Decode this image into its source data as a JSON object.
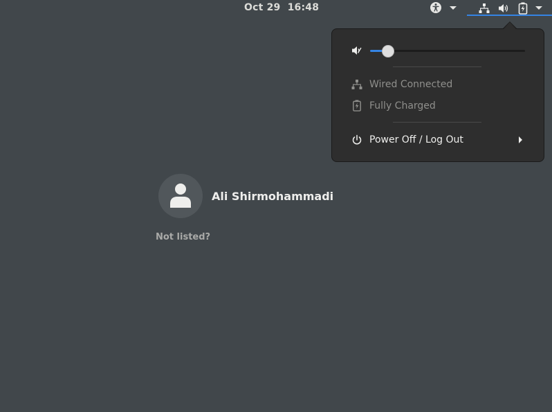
{
  "topbar": {
    "clock": "Oct 29  16:48",
    "accessibility_icon": "accessibility-icon",
    "status_icons": [
      "network-wired-icon",
      "audio-volume-icon",
      "battery-charging-icon"
    ]
  },
  "system_menu": {
    "volume": {
      "icon": "audio-volume-muted-icon",
      "level": 0.08
    },
    "network": {
      "icon": "network-wired-icon",
      "label": "Wired Connected"
    },
    "battery": {
      "icon": "battery-charged-icon",
      "label": "Fully Charged"
    },
    "power": {
      "icon": "power-icon",
      "label": "Power Off / Log Out"
    }
  },
  "login": {
    "user_name": "Ali Shirmohammadi",
    "avatar_icon": "avatar-default-icon",
    "not_listed": "Not listed?"
  },
  "colors": {
    "background": "#41474b",
    "accent": "#3584e4",
    "popover": "#2e2e2e"
  }
}
